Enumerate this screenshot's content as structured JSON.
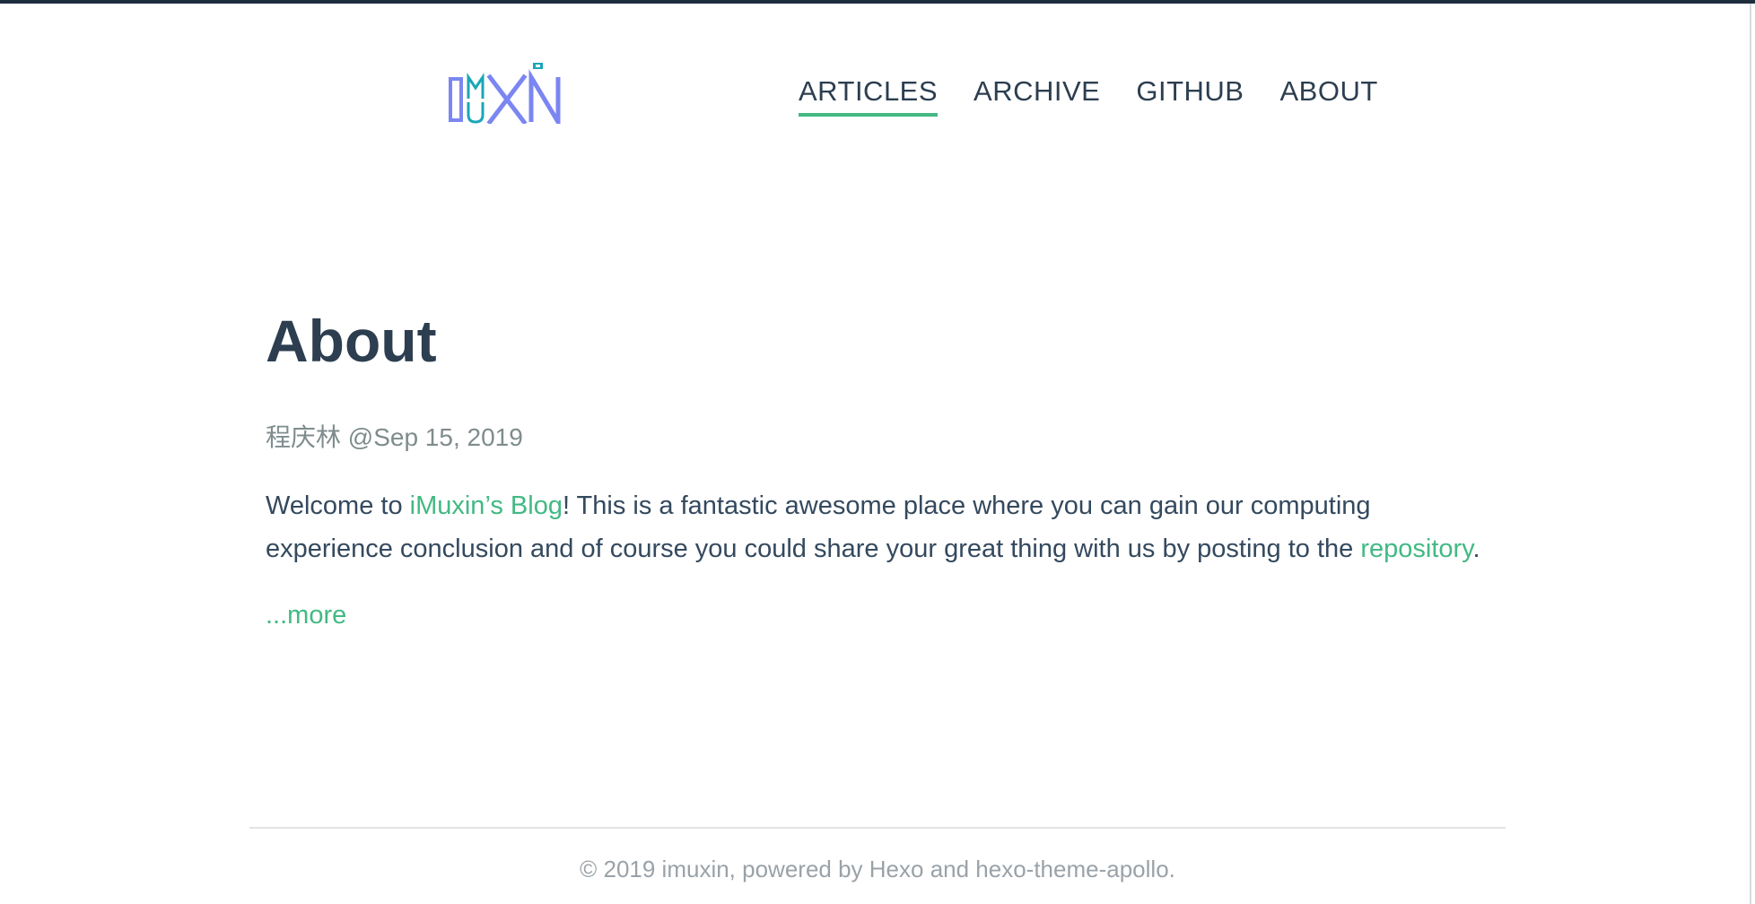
{
  "header": {
    "logo_text": "IMUXIN",
    "nav": [
      {
        "label": "ARTICLES",
        "active": true
      },
      {
        "label": "ARCHIVE",
        "active": false
      },
      {
        "label": "GITHUB",
        "active": false
      },
      {
        "label": "ABOUT",
        "active": false
      }
    ]
  },
  "main": {
    "title": "About",
    "meta": "程庆林 @Sep 15, 2019",
    "content": {
      "part1": "Welcome to ",
      "blog_link": "iMuxin’s Blog",
      "part2": "! This is a fantastic awesome place where you can gain our computing experience conclusion and of course you could share your great thing with us by posting to the ",
      "repo_link": "repository",
      "part3": "."
    },
    "more_label": "...more"
  },
  "footer": {
    "text": "© 2019 imuxin, powered by Hexo and hexo-theme-apollo."
  },
  "colors": {
    "accent": "#42b983",
    "text": "#2c3e50",
    "logo": "#7b86f2",
    "logo_accent": "#1aa6b7"
  }
}
